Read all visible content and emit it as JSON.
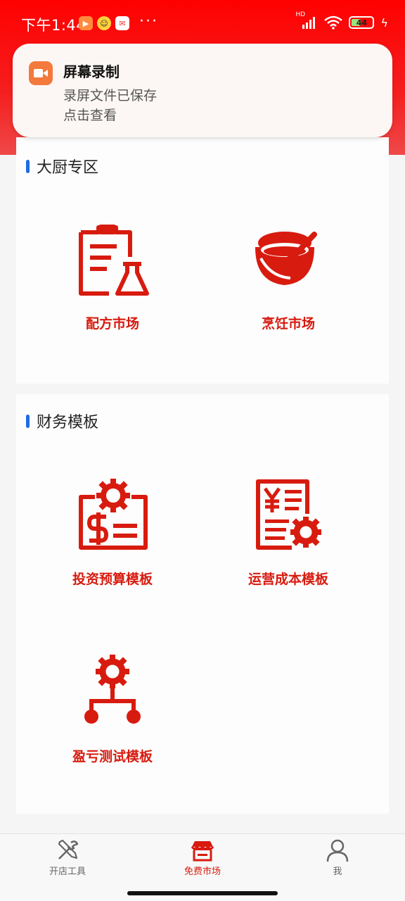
{
  "status_bar": {
    "time": "下午1:44",
    "dots": "···",
    "battery": "44",
    "battery_level": 0.44,
    "hd": "HD"
  },
  "notification": {
    "app": "屏幕录制",
    "line1": "录屏文件已保存",
    "line2": "点击查看",
    "accent": "#f37a3c"
  },
  "sections": [
    {
      "title": "大厨专区",
      "items": [
        {
          "label": "配方市场",
          "icon": "recipe-clipboard-flask-icon"
        },
        {
          "label": "烹饪市场",
          "icon": "bowl-spoon-icon"
        }
      ]
    },
    {
      "title": "财务模板",
      "items": [
        {
          "label": "投资预算模板",
          "icon": "dollar-gear-icon"
        },
        {
          "label": "运营成本模板",
          "icon": "yen-document-gear-icon"
        },
        {
          "label": "盈亏测试模板",
          "icon": "gear-flow-icon"
        }
      ]
    }
  ],
  "tabbar": {
    "tabs": [
      {
        "label": "开店工具",
        "icon": "tools-icon",
        "active": false
      },
      {
        "label": "免费市场",
        "icon": "store-icon",
        "active": true
      },
      {
        "label": "我",
        "icon": "user-icon",
        "active": false
      }
    ]
  },
  "colors": {
    "header_red": "#ff0000",
    "accent_red": "#d81b0f",
    "section_bar": "#1c6ce5"
  }
}
